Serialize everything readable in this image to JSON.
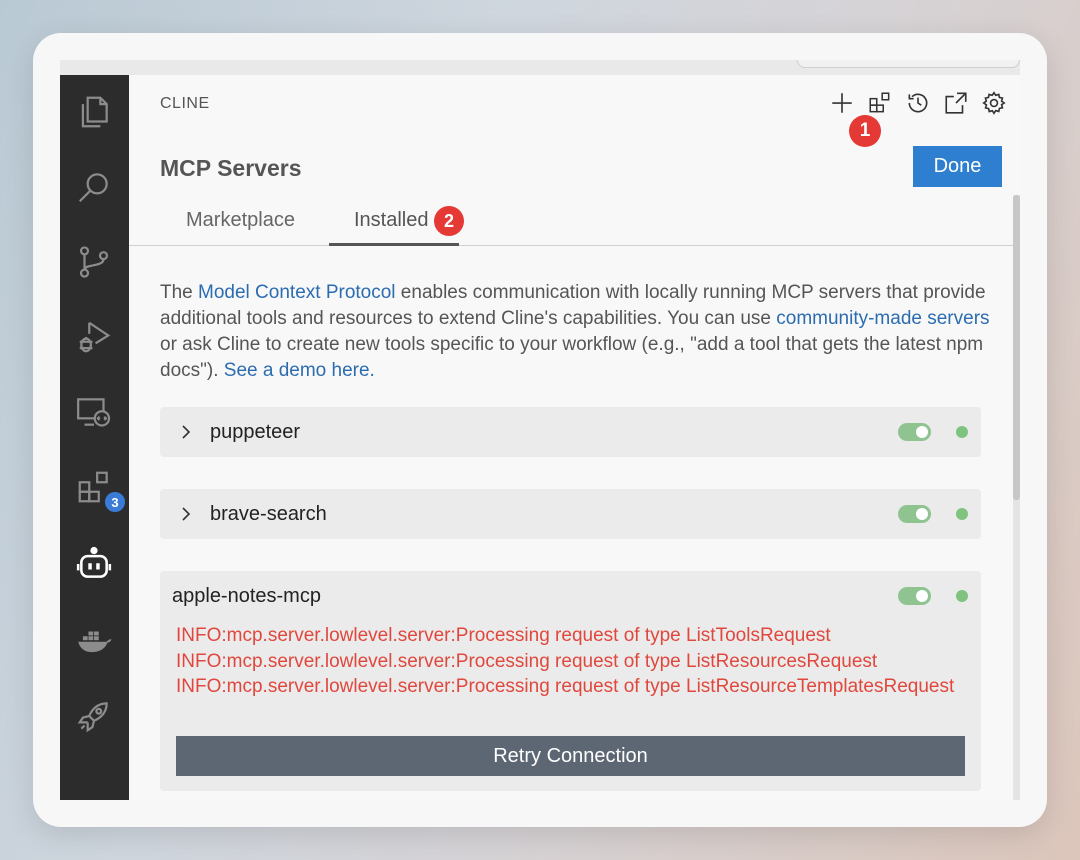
{
  "app": {
    "panel_title": "CLINE"
  },
  "activity_bar": {
    "items": [
      {
        "name": "explorer-icon"
      },
      {
        "name": "search-icon"
      },
      {
        "name": "source-control-icon"
      },
      {
        "name": "run-debug-icon"
      },
      {
        "name": "remote-explorer-icon"
      },
      {
        "name": "extensions-icon",
        "badge": "3"
      },
      {
        "name": "cline-icon"
      },
      {
        "name": "docker-icon"
      },
      {
        "name": "rocket-icon"
      }
    ]
  },
  "toolbar": {
    "items": [
      "plus-icon",
      "mcp-servers-icon",
      "history-icon",
      "popout-icon",
      "gear-icon"
    ]
  },
  "markers": {
    "one": "1",
    "two": "2"
  },
  "header": {
    "title": "MCP Servers",
    "done_label": "Done"
  },
  "tabs": {
    "marketplace": "Marketplace",
    "installed": "Installed"
  },
  "description": {
    "part1": "The ",
    "link1": "Model Context Protocol",
    "part2": " enables communication with locally running MCP servers that provide additional tools and resources to extend Cline's capabilities. You can use ",
    "link2": "community-made servers",
    "part3": " or ask Cline to create new tools specific to your workflow (e.g., \"add a tool that gets the latest npm docs\"). ",
    "link3": "See a demo here."
  },
  "servers": [
    {
      "name": "puppeteer",
      "enabled": true
    },
    {
      "name": "brave-search",
      "enabled": true
    },
    {
      "name": "apple-notes-mcp",
      "enabled": true,
      "logs": [
        "INFO:mcp.server.lowlevel.server:Processing request of type ListToolsRequest",
        "INFO:mcp.server.lowlevel.server:Processing request of type ListResourcesRequest",
        "INFO:mcp.server.lowlevel.server:Processing request of type ListResourceTemplatesRequest"
      ],
      "retry_label": "Retry Connection"
    }
  ],
  "colors": {
    "accent": "#2f7fd0",
    "error": "#e0483e",
    "toggle_on": "#8fc491",
    "status_ok": "#7fc37f"
  }
}
